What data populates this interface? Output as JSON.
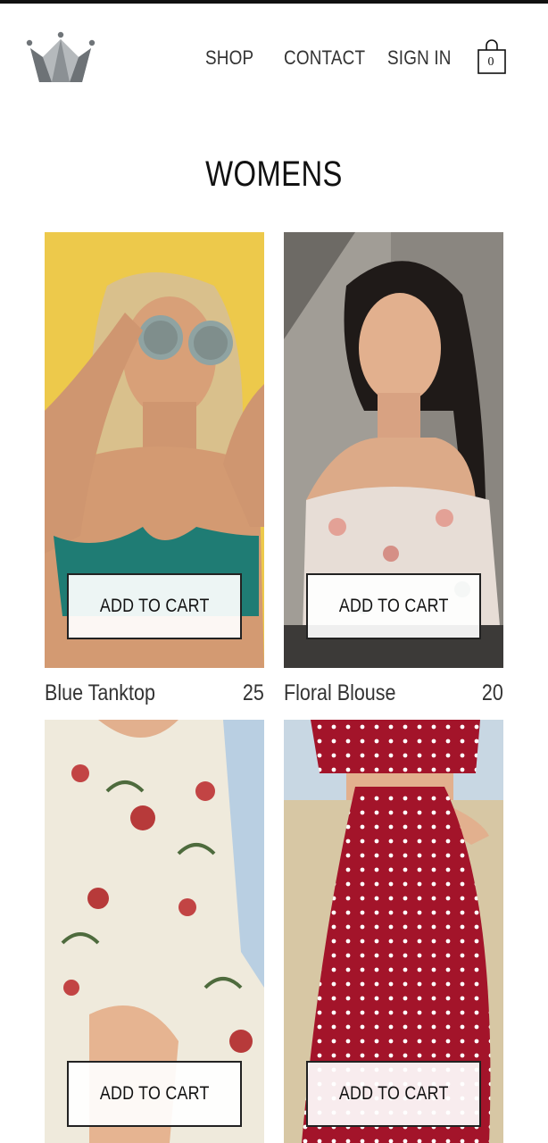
{
  "nav": {
    "shop_label": "SHOP",
    "contact_label": "CONTACT",
    "signin_label": "SIGN IN",
    "cart_count": "0"
  },
  "page": {
    "title": "WOMENS"
  },
  "products": [
    {
      "name": "Blue Tanktop",
      "price": "25",
      "button_label": "ADD TO CART"
    },
    {
      "name": "Floral Blouse",
      "price": "20",
      "button_label": "ADD TO CART"
    },
    {
      "name": "",
      "price": "",
      "button_label": "ADD TO CART"
    },
    {
      "name": "",
      "price": "",
      "button_label": "ADD TO CART"
    }
  ],
  "colors": {
    "logo_gray": "#7a7f83",
    "logo_light": "#b6babd",
    "text": "#333333",
    "button_border": "#222222"
  }
}
